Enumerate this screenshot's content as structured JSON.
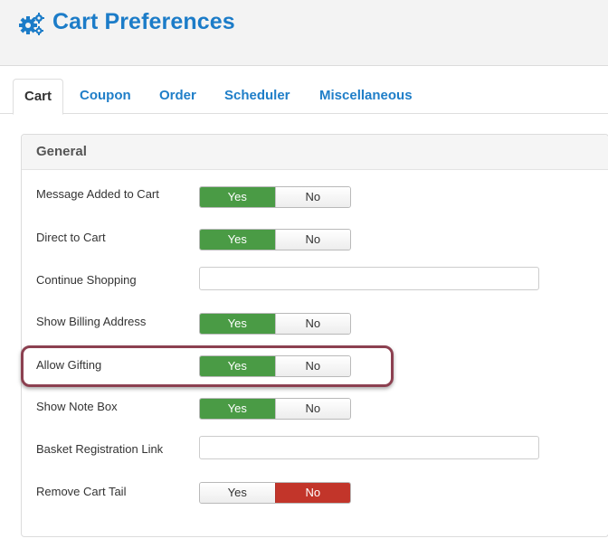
{
  "header": {
    "title": "Cart Preferences",
    "icon": "gears-icon"
  },
  "tabs": [
    {
      "label": "Cart",
      "active": true
    },
    {
      "label": "Coupon"
    },
    {
      "label": "Order"
    },
    {
      "label": "Scheduler"
    },
    {
      "label": "Miscellaneous"
    }
  ],
  "panel": {
    "title": "General"
  },
  "toggle_labels": {
    "yes": "Yes",
    "no": "No"
  },
  "rows": [
    {
      "label": "Message Added to Cart",
      "type": "toggle",
      "value": "Yes"
    },
    {
      "label": "Direct to Cart",
      "type": "toggle",
      "value": "Yes"
    },
    {
      "label": "Continue Shopping",
      "type": "text",
      "value": ""
    },
    {
      "label": "Show Billing Address",
      "type": "toggle",
      "value": "Yes"
    },
    {
      "label": "Allow Gifting",
      "type": "toggle",
      "value": "Yes",
      "highlighted": true
    },
    {
      "label": "Show Note Box",
      "type": "toggle",
      "value": "Yes"
    },
    {
      "label": "Basket Registration Link",
      "type": "text",
      "value": ""
    },
    {
      "label": "Remove Cart Tail",
      "type": "toggle",
      "value": "No"
    }
  ],
  "colors": {
    "accent": "#1c7cc8",
    "yes_on": "#4a9b45",
    "no_on": "#c2352a",
    "highlight": "#8c4050"
  }
}
